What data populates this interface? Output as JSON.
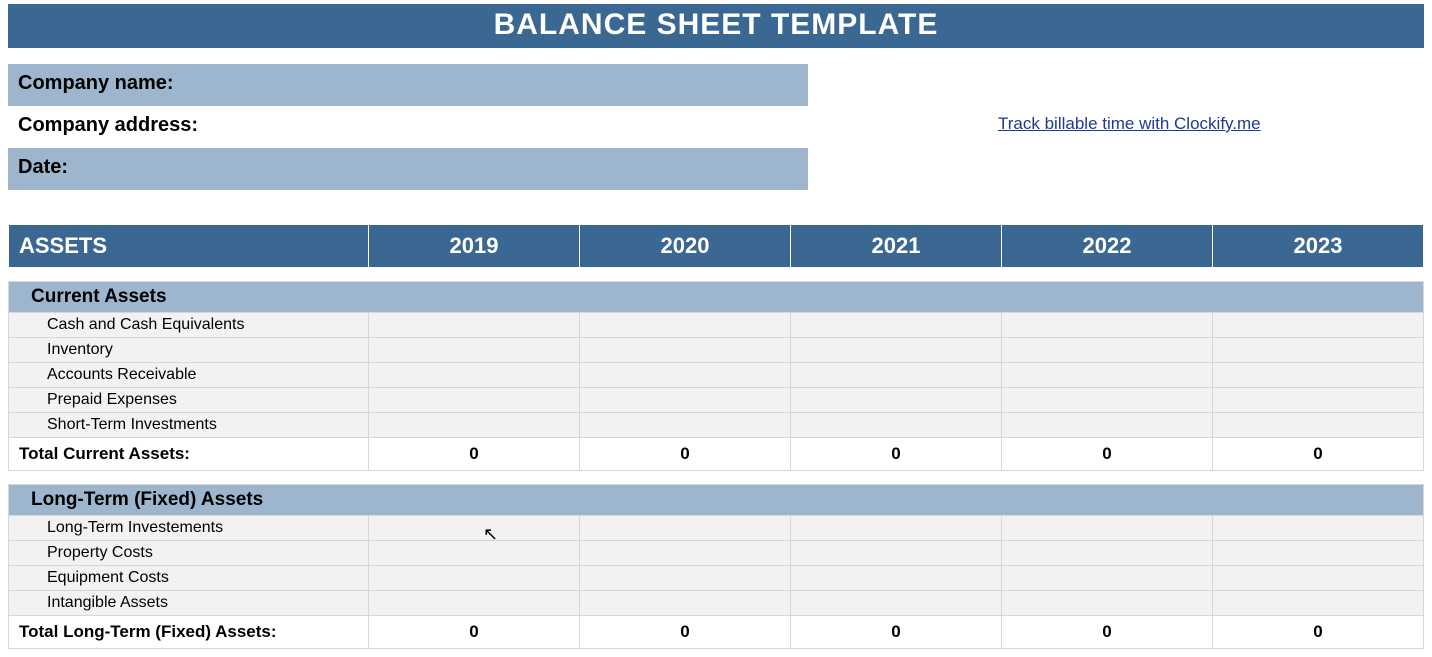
{
  "title": "BALANCE SHEET TEMPLATE",
  "info": {
    "company_name_label": "Company name:",
    "company_address_label": "Company address:",
    "date_label": "Date:"
  },
  "link": {
    "text": "Track billable time with Clockify.me"
  },
  "table": {
    "header_label": "ASSETS",
    "years": [
      "2019",
      "2020",
      "2021",
      "2022",
      "2023"
    ],
    "sections": [
      {
        "title": "Current Assets",
        "items": [
          "Cash and Cash Equivalents",
          "Inventory",
          "Accounts Receivable",
          "Prepaid Expenses",
          "Short-Term Investments"
        ],
        "total_label": "Total Current Assets:",
        "totals": [
          "0",
          "0",
          "0",
          "0",
          "0"
        ]
      },
      {
        "title": "Long-Term (Fixed) Assets",
        "items": [
          "Long-Term Investements",
          "Property Costs",
          "Equipment Costs",
          "Intangible Assets"
        ],
        "total_label": "Total Long-Term (Fixed) Assets:",
        "totals": [
          "0",
          "0",
          "0",
          "0",
          "0"
        ]
      }
    ]
  }
}
